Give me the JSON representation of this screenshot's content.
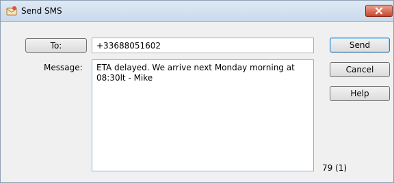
{
  "window": {
    "title": "Send SMS",
    "icons": {
      "app": "sms-envelope-icon",
      "close": "close-icon"
    },
    "colors": {
      "close_button": "#c8442b",
      "default_button_border": "#3c7fb1",
      "focus_border": "#7eb4ea"
    }
  },
  "form": {
    "to_button_label": "To:",
    "to_value": "+33688051602",
    "message_label": "Message:",
    "message_value": "ETA delayed. We arrive next Monday morning at 08:30lt - Mike",
    "char_count": "79 (1)"
  },
  "actions": {
    "send_label": "Send",
    "cancel_label": "Cancel",
    "help_label": "Help"
  }
}
